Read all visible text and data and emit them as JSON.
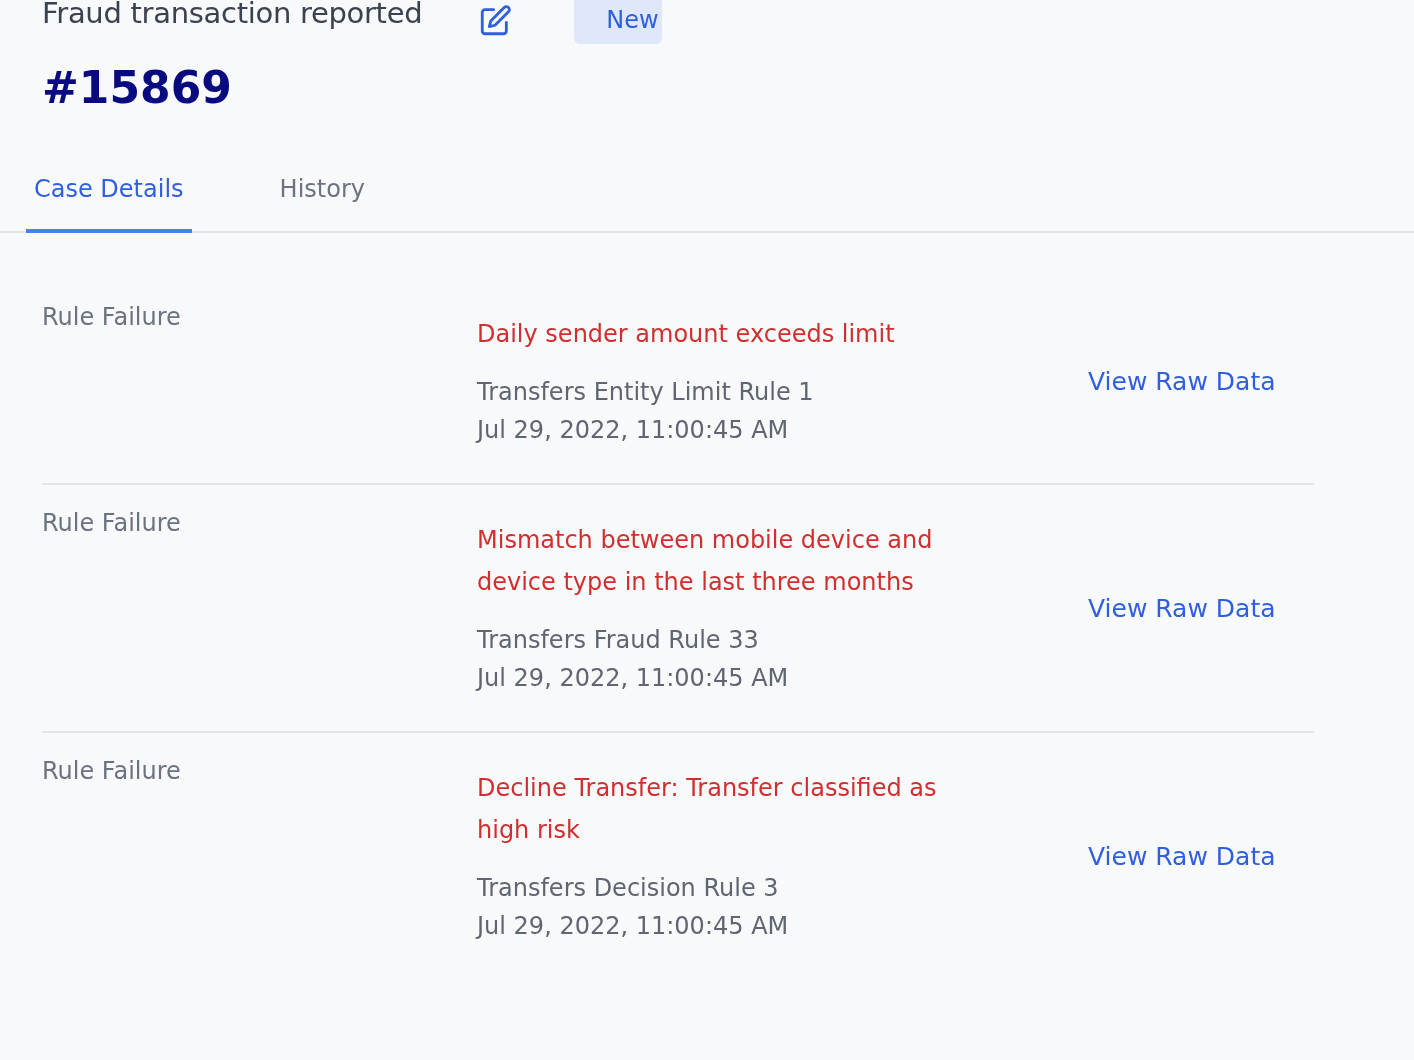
{
  "header": {
    "title": "Fraud transaction reported",
    "status_badge": "New",
    "case_number": "#15869"
  },
  "tabs": [
    {
      "label": "Case Details",
      "selected": true
    },
    {
      "label": "History",
      "selected": false
    }
  ],
  "rules": [
    {
      "label": "Rule Failure",
      "message": "Daily sender amount exceeds limit",
      "rule_name": "Transfers Entity Limit Rule 1",
      "timestamp": "Jul 29, 2022, 11:00:45 AM",
      "link": "View Raw Data"
    },
    {
      "label": "Rule Failure",
      "message": "Mismatch between mobile device and device type in the last three months",
      "rule_name": "Transfers Fraud Rule 33",
      "timestamp": "Jul 29, 2022, 11:00:45 AM",
      "link": "View Raw Data"
    },
    {
      "label": "Rule Failure",
      "message": "Decline Transfer: Transfer classified as high risk",
      "rule_name": "Transfers Decision Rule 3",
      "timestamp": "Jul 29, 2022, 11:00:45 AM",
      "link": "View Raw Data"
    }
  ]
}
